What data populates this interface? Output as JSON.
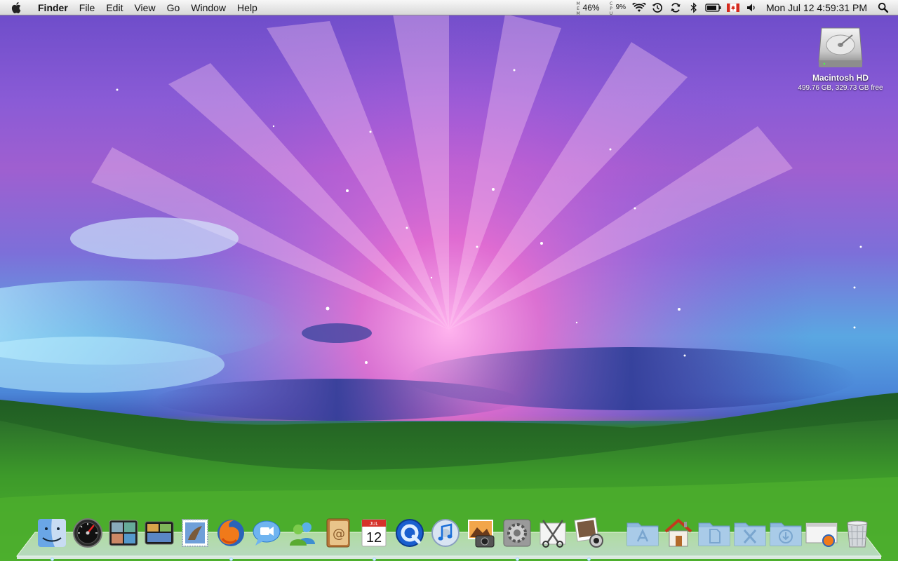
{
  "menubar": {
    "app_name": "Finder",
    "menus": [
      "File",
      "Edit",
      "View",
      "Go",
      "Window",
      "Help"
    ],
    "mem_label": "MEM",
    "mem_value": "46%",
    "cpu_label": "CPU",
    "cpu_value": "9%",
    "clock": "Mon Jul 12  4:59:31 PM",
    "icons": [
      "apple-logo",
      "wifi-icon",
      "time-machine-icon",
      "sync-icon",
      "bluetooth-icon",
      "battery-icon",
      "canada-flag-icon",
      "volume-icon",
      "spotlight-icon"
    ]
  },
  "desktop": {
    "disk_name": "Macintosh HD",
    "disk_info": "499.76 GB, 329.73 GB free"
  },
  "dock": {
    "apps": [
      "finder",
      "dashboard",
      "spaces",
      "expose",
      "mail",
      "firefox",
      "ichat",
      "messenger",
      "address-book",
      "ical",
      "quicktime",
      "itunes",
      "iphoto",
      "system-preferences",
      "scissors-utility",
      "photo-booth"
    ],
    "calendar_month": "JUL",
    "calendar_day": "12",
    "folders": [
      "applications",
      "home",
      "documents",
      "utilities",
      "downloads",
      "firefox-installer",
      "trash"
    ]
  },
  "colors": {
    "menubar": "#e6e6e6",
    "sky_pink": "#f06bd0",
    "grass": "#3c9a2a",
    "folder_blue": "#8fb8dc"
  }
}
